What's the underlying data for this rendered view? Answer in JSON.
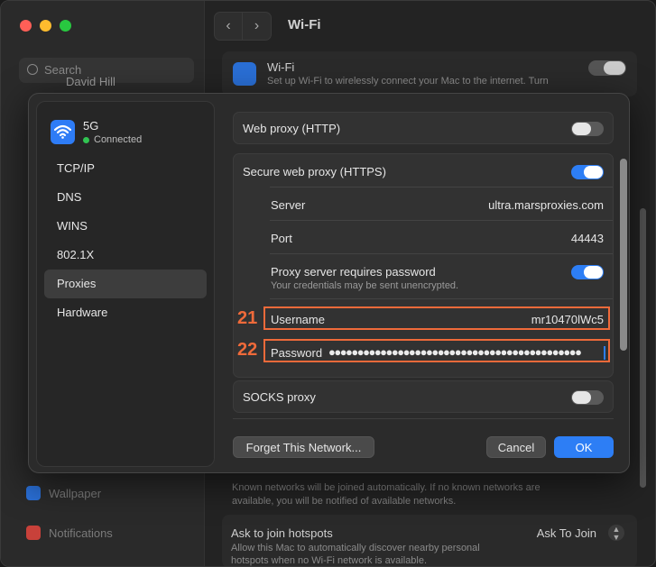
{
  "background": {
    "search_placeholder": "Search",
    "user_name": "David Hill",
    "sidebar_wallpaper": "Wallpaper",
    "sidebar_notifications": "Notifications",
    "window_title": "Wi-Fi",
    "wifi_card": {
      "title": "Wi-Fi",
      "description": "Set up Wi-Fi to wirelessly connect your Mac to the internet. Turn"
    },
    "known_networks_note": "Known networks will be joined automatically. If no known networks are available, you will be notified of available networks.",
    "hotspot": {
      "title": "Ask to join hotspots",
      "description": "Allow this Mac to automatically discover nearby personal hotspots when no Wi-Fi network is available.",
      "value": "Ask To Join"
    }
  },
  "dialog": {
    "network": {
      "name": "5G",
      "status": "Connected"
    },
    "nav_items": [
      "TCP/IP",
      "DNS",
      "WINS",
      "802.1X",
      "Proxies",
      "Hardware"
    ],
    "active_nav": "Proxies",
    "web_proxy": {
      "label": "Web proxy (HTTP)",
      "enabled": false
    },
    "secure_proxy": {
      "label": "Secure web proxy (HTTPS)",
      "enabled": true,
      "server_label": "Server",
      "server_value": "ultra.marsproxies.com",
      "port_label": "Port",
      "port_value": "44443",
      "auth_label": "Proxy server requires password",
      "auth_note": "Your credentials may be sent unencrypted.",
      "auth_enabled": true,
      "username_label": "Username",
      "username_value": "mr10470lWc5",
      "password_label": "Password",
      "password_value": "●●●●●●●●●●●●●●●●●●●●●●●●●●●●●●●●●●●●●●●●●●●●"
    },
    "socks_proxy": {
      "label": "SOCKS proxy",
      "enabled": false
    },
    "annotations": {
      "username_marker": "21",
      "password_marker": "22"
    },
    "buttons": {
      "forget": "Forget This Network...",
      "cancel": "Cancel",
      "ok": "OK"
    }
  },
  "colors": {
    "accent": "#2d7ef5",
    "highlight": "#ef6a3a",
    "connected": "#31c452"
  }
}
